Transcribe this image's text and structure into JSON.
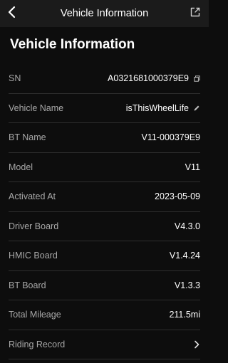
{
  "nav": {
    "title": "Vehicle Information",
    "back_icon": "chevron-left-icon",
    "share_icon": "share-export-icon"
  },
  "page": {
    "title": "Vehicle Information"
  },
  "rows": {
    "sn": {
      "label": "SN",
      "value": "A0321681000379E9",
      "icon": "copy-icon"
    },
    "vehicle_name": {
      "label": "Vehicle Name",
      "value": "isThisWheelLife",
      "icon": "edit-pencil-icon"
    },
    "bt_name": {
      "label": "BT Name",
      "value": "V11-000379E9"
    },
    "model": {
      "label": "Model",
      "value": "V11"
    },
    "activated_at": {
      "label": "Activated At",
      "value": "2023-05-09"
    },
    "driver_board": {
      "label": "Driver Board",
      "value": "V4.3.0"
    },
    "hmic_board": {
      "label": "HMIC Board",
      "value": "V1.4.24"
    },
    "bt_board": {
      "label": "BT Board",
      "value": "V1.3.3"
    },
    "total_mileage": {
      "label": "Total Mileage",
      "value": "211.5mi"
    },
    "riding_record": {
      "label": "Riding Record",
      "icon": "chevron-right-icon"
    }
  },
  "colors": {
    "background": "#0d0d0d",
    "topbar": "#1b1b1b",
    "label": "#a8a8a8",
    "value": "#ffffff",
    "divider": "#2e2e2e"
  }
}
